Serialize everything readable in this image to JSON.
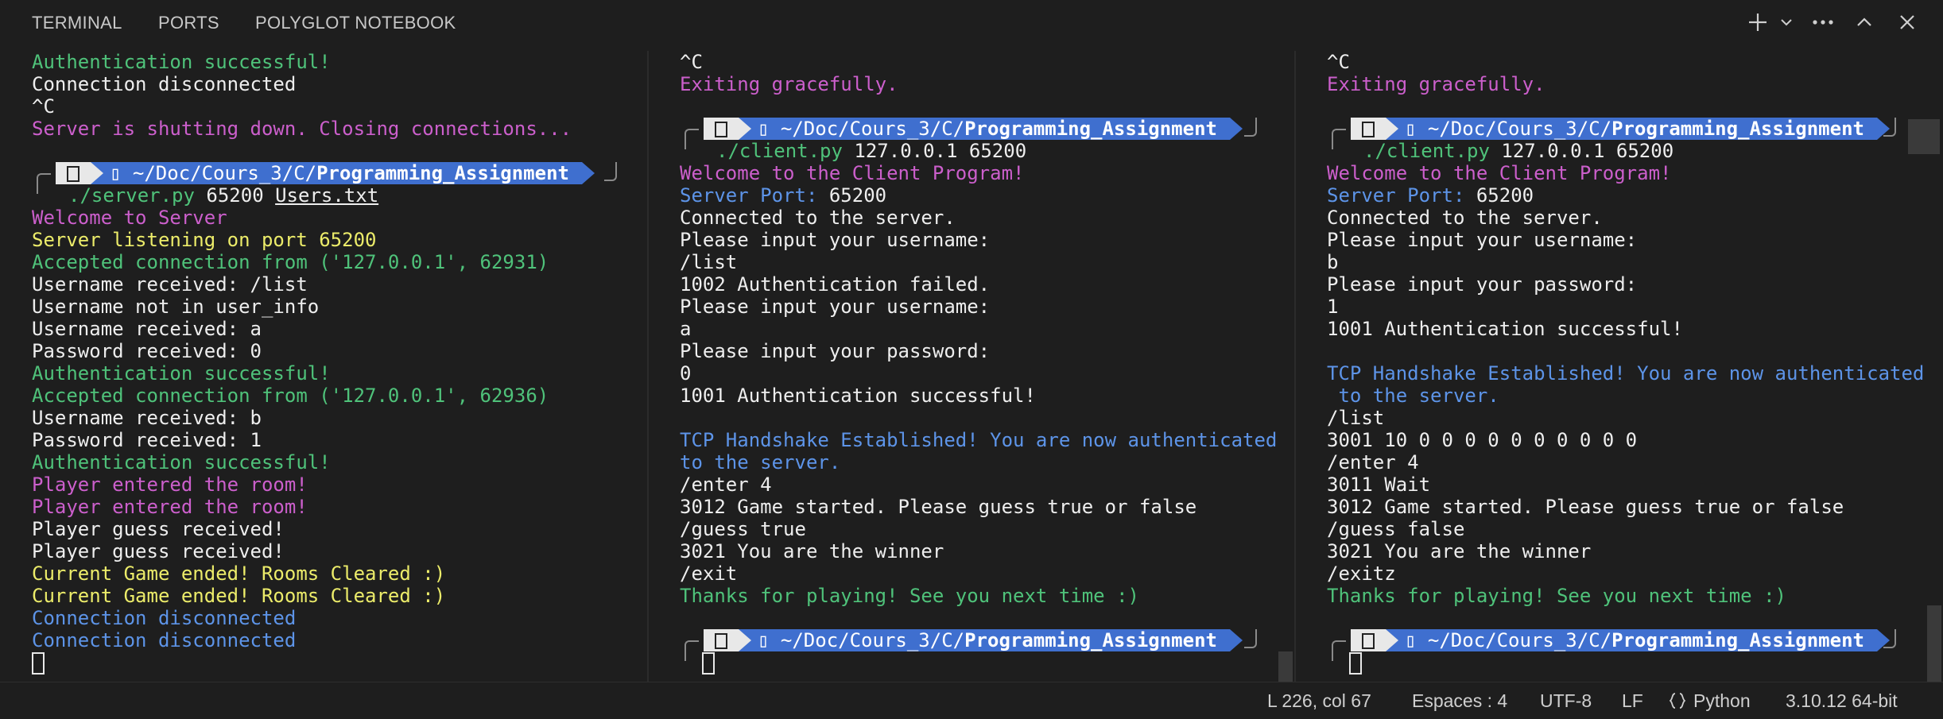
{
  "tabs": [
    "TERMINAL",
    "PORTS",
    "POLYGLOT NOTEBOOK"
  ],
  "toolbar": {
    "new_terminal_icon": "plus-icon",
    "dropdown_icon": "chevron-down-icon",
    "more_icon": "ellipsis-icon",
    "maximize_icon": "chevron-up-icon",
    "close_icon": "close-icon"
  },
  "colors": {
    "background": "#1e1e1e",
    "green": "#4fc27a",
    "magenta": "#cc5fcc",
    "yellow": "#ecec6a",
    "blue": "#5d94e8",
    "prompt_path_bg": "#3f6fcf"
  },
  "prompt": {
    "path_prefix": "~/Doc/Cours_3/C/",
    "path_bold": "Programming_Assignment",
    "glyph": "▯"
  },
  "server_pane": {
    "pre_lines": [
      {
        "text": "Authentication successful!",
        "color": "green"
      },
      {
        "text": "Connection disconnected",
        "color": "white"
      },
      {
        "text": "^C",
        "color": "white"
      },
      {
        "text": "Server is shutting down. Closing connections...",
        "color": "magenta"
      },
      {
        "text": "",
        "color": "white"
      }
    ],
    "command": {
      "exe": "./server.py",
      "args": " 65200 ",
      "file": "Users.txt"
    },
    "post_lines": [
      {
        "text": "Welcome to Server",
        "color": "magenta"
      },
      {
        "text": "Server listening on port 65200",
        "color": "yellow"
      },
      {
        "text": "Accepted connection from ('127.0.0.1', 62931)",
        "color": "green"
      },
      {
        "text": "Username received: /list",
        "color": "white"
      },
      {
        "text": "Username not in user_info",
        "color": "white"
      },
      {
        "text": "Username received: a",
        "color": "white"
      },
      {
        "text": "Password received: 0",
        "color": "white"
      },
      {
        "text": "Authentication successful!",
        "color": "green"
      },
      {
        "text": "Accepted connection from ('127.0.0.1', 62936)",
        "color": "green"
      },
      {
        "text": "Username received: b",
        "color": "white"
      },
      {
        "text": "Password received: 1",
        "color": "white"
      },
      {
        "text": "Authentication successful!",
        "color": "green"
      },
      {
        "text": "Player entered the room!",
        "color": "magenta"
      },
      {
        "text": "Player entered the room!",
        "color": "magenta"
      },
      {
        "text": "Player guess received!",
        "color": "white"
      },
      {
        "text": "Player guess received!",
        "color": "white"
      },
      {
        "text": "Current Game ended! Rooms Cleared :)",
        "color": "yellow"
      },
      {
        "text": "Current Game ended! Rooms Cleared :)",
        "color": "yellow"
      },
      {
        "text": "Connection disconnected",
        "color": "blue"
      },
      {
        "text": "Connection disconnected",
        "color": "blue"
      }
    ]
  },
  "client1_pane": {
    "pre_lines": [
      {
        "text": "^C",
        "color": "white"
      },
      {
        "text": "Exiting gracefully.",
        "color": "magenta"
      },
      {
        "text": "",
        "color": "white"
      }
    ],
    "command": {
      "exe": "./client.py",
      "args": " 127.0.0.1 65200",
      "file": ""
    },
    "post_lines": [
      {
        "text": "Welcome to the Client Program!",
        "color": "magenta"
      },
      {
        "text": "Server Port: |65200",
        "color": "blue"
      },
      {
        "text": "Connected to the server.",
        "color": "white"
      },
      {
        "text": "Please input your username:",
        "color": "white"
      },
      {
        "text": "/list",
        "color": "white"
      },
      {
        "text": "1002 Authentication failed.",
        "color": "white"
      },
      {
        "text": "Please input your username:",
        "color": "white"
      },
      {
        "text": "a",
        "color": "white"
      },
      {
        "text": "Please input your password:",
        "color": "white"
      },
      {
        "text": "0",
        "color": "white"
      },
      {
        "text": "1001 Authentication successful!",
        "color": "white"
      },
      {
        "text": "",
        "color": "white"
      },
      {
        "text": "TCP Handshake Established! You are now authenticated",
        "color": "blue"
      },
      {
        "text": "to the server.",
        "color": "blue"
      },
      {
        "text": "/enter 4",
        "color": "white"
      },
      {
        "text": "3012 Game started. Please guess true or false",
        "color": "white"
      },
      {
        "text": "/guess true",
        "color": "white"
      },
      {
        "text": "3021 You are the winner",
        "color": "white"
      },
      {
        "text": "/exit",
        "color": "white"
      },
      {
        "text": "Thanks for playing! See you next time :)",
        "color": "green"
      },
      {
        "text": "",
        "color": "white"
      }
    ]
  },
  "client2_pane": {
    "pre_lines": [
      {
        "text": "^C",
        "color": "white"
      },
      {
        "text": "Exiting gracefully.",
        "color": "magenta"
      },
      {
        "text": "",
        "color": "white"
      }
    ],
    "command": {
      "exe": "./client.py",
      "args": " 127.0.0.1 65200",
      "file": ""
    },
    "post_lines": [
      {
        "text": "Welcome to the Client Program!",
        "color": "magenta"
      },
      {
        "text": "Server Port: |65200",
        "color": "blue"
      },
      {
        "text": "Connected to the server.",
        "color": "white"
      },
      {
        "text": "Please input your username:",
        "color": "white"
      },
      {
        "text": "b",
        "color": "white"
      },
      {
        "text": "Please input your password:",
        "color": "white"
      },
      {
        "text": "1",
        "color": "white"
      },
      {
        "text": "1001 Authentication successful!",
        "color": "white"
      },
      {
        "text": "",
        "color": "white"
      },
      {
        "text": "TCP Handshake Established! You are now authenticated",
        "color": "blue"
      },
      {
        "text": " to the server.",
        "color": "blue"
      },
      {
        "text": "/list",
        "color": "white"
      },
      {
        "text": "3001 10 0 0 0 0 0 0 0 0 0 0",
        "color": "white"
      },
      {
        "text": "/enter 4",
        "color": "white"
      },
      {
        "text": "3011 Wait",
        "color": "white"
      },
      {
        "text": "3012 Game started. Please guess true or false",
        "color": "white"
      },
      {
        "text": "/guess false",
        "color": "white"
      },
      {
        "text": "3021 You are the winner",
        "color": "white"
      },
      {
        "text": "/exitz",
        "color": "white"
      },
      {
        "text": "Thanks for playing! See you next time :)",
        "color": "green"
      },
      {
        "text": "",
        "color": "white"
      }
    ]
  },
  "status": {
    "cursor_pos": "L 226, col 67",
    "indent": "Espaces : 4",
    "encoding": "UTF-8",
    "eol": "LF",
    "language_icon": "braces-icon",
    "language": "Python",
    "interpreter": "3.10.12 64-bit"
  }
}
